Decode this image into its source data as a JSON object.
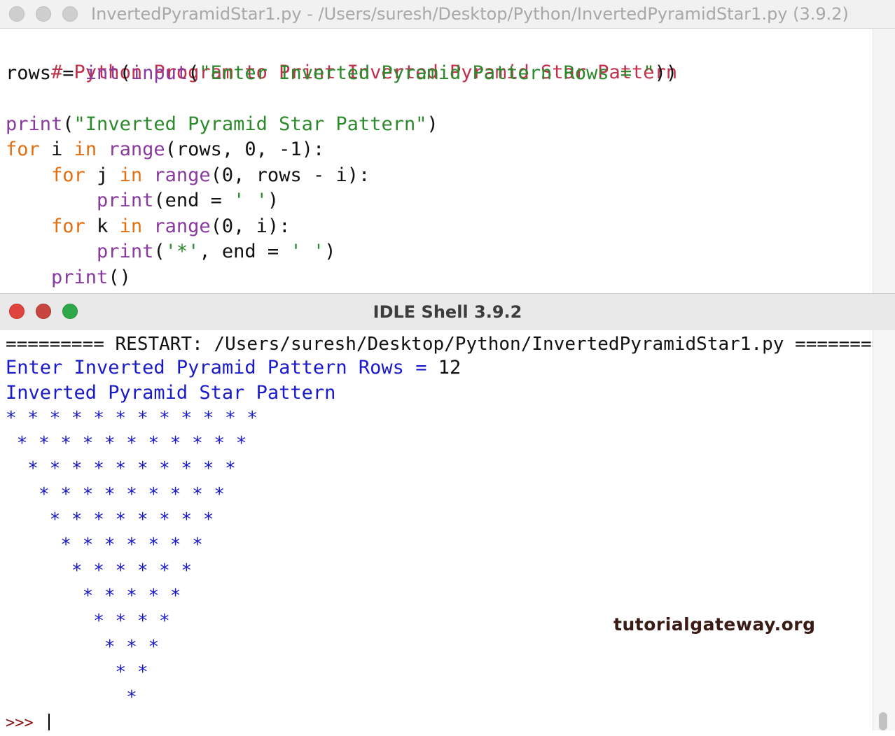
{
  "editor": {
    "title": "InvertedPyramidStar1.py - /Users/suresh/Desktop/Python/InvertedPyramidStar1.py (3.9.2)",
    "code": {
      "line1": {
        "comment": "# Python Program to Print Inverted Pyramid Star Pattern"
      },
      "line2": {
        "a": "rows = ",
        "b": "int",
        "c": "(",
        "d": "input",
        "e": "(",
        "f": "\"Enter Inverted Pyramid Pattern Rows = \"",
        "g": "))"
      },
      "line4": {
        "a": "print",
        "b": "(",
        "c": "\"Inverted Pyramid Star Pattern\"",
        "d": ")"
      },
      "line5": {
        "a": "for",
        "b": " i ",
        "c": "in",
        "d": " ",
        "e": "range",
        "f": "(rows, 0, -1):"
      },
      "line6": {
        "a": "    ",
        "b": "for",
        "c": " j ",
        "d": "in",
        "e": " ",
        "f": "range",
        "g": "(0, rows - i):"
      },
      "line7": {
        "a": "        ",
        "b": "print",
        "c": "(end = ",
        "d": "' '",
        "e": ")"
      },
      "line8": {
        "a": "    ",
        "b": "for",
        "c": " k ",
        "d": "in",
        "e": " ",
        "f": "range",
        "g": "(0, i):"
      },
      "line9": {
        "a": "        ",
        "b": "print",
        "c": "(",
        "d": "'*'",
        "e": ", end = ",
        "f": "' '",
        "g": ")"
      },
      "line10": {
        "a": "    ",
        "b": "print",
        "c": "()"
      }
    }
  },
  "shell": {
    "title": "IDLE Shell 3.9.2",
    "restart_line": "========= RESTART: /Users/suresh/Desktop/Python/InvertedPyramidStar1.py ========",
    "input_prompt": "Enter Inverted Pyramid Pattern Rows = ",
    "input_value": "12",
    "output_heading": "Inverted Pyramid Star Pattern",
    "star_rows": [
      "* * * * * * * * * * * * ",
      " * * * * * * * * * * * ",
      "  * * * * * * * * * * ",
      "   * * * * * * * * * ",
      "    * * * * * * * * ",
      "     * * * * * * * ",
      "      * * * * * * ",
      "       * * * * * ",
      "        * * * * ",
      "         * * * ",
      "          * * ",
      "           * "
    ],
    "prompt": ">>> "
  },
  "watermark": "tutorialgateway.org",
  "colors": {
    "comment": "#c0304a",
    "keyword": "#e36f12",
    "builtin": "#8a3a9e",
    "string": "#2c8a2c",
    "output": "#1a1acd",
    "traffic_red": "#e0443e",
    "traffic_green": "#2fa84a"
  }
}
